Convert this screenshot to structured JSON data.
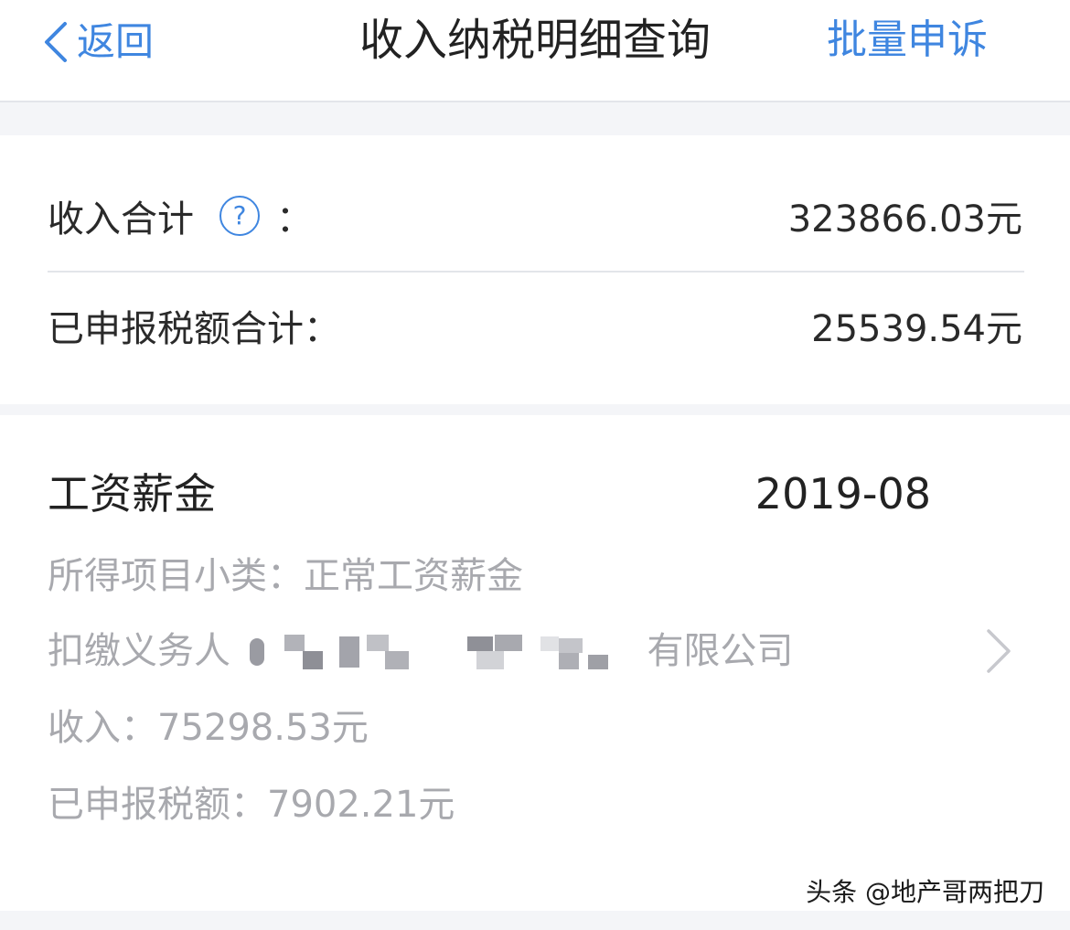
{
  "navbar": {
    "back_label": "返回",
    "title": "收入纳税明细查询",
    "action_label": "批量申诉"
  },
  "summary": {
    "income_total_label": "收入合计",
    "income_total_colon": "：",
    "income_total_value": "323866.03元",
    "tax_total_label": "已申报税额合计：",
    "tax_total_value": "25539.54元"
  },
  "detail": {
    "title": "工资薪金",
    "date": "2019-08",
    "subcategory_line": "所得项目小类：正常工资薪金",
    "payer_prefix": "扣缴义务人",
    "payer_suffix": "有限公司",
    "income_line": "收入：75298.53元",
    "tax_line": "已申报税额：7902.21元"
  },
  "watermark": "头条 @地产哥两把刀",
  "colors": {
    "accent": "#3f86e0",
    "secondary_text": "#a8a9ae",
    "background_band": "#f4f5f8"
  }
}
